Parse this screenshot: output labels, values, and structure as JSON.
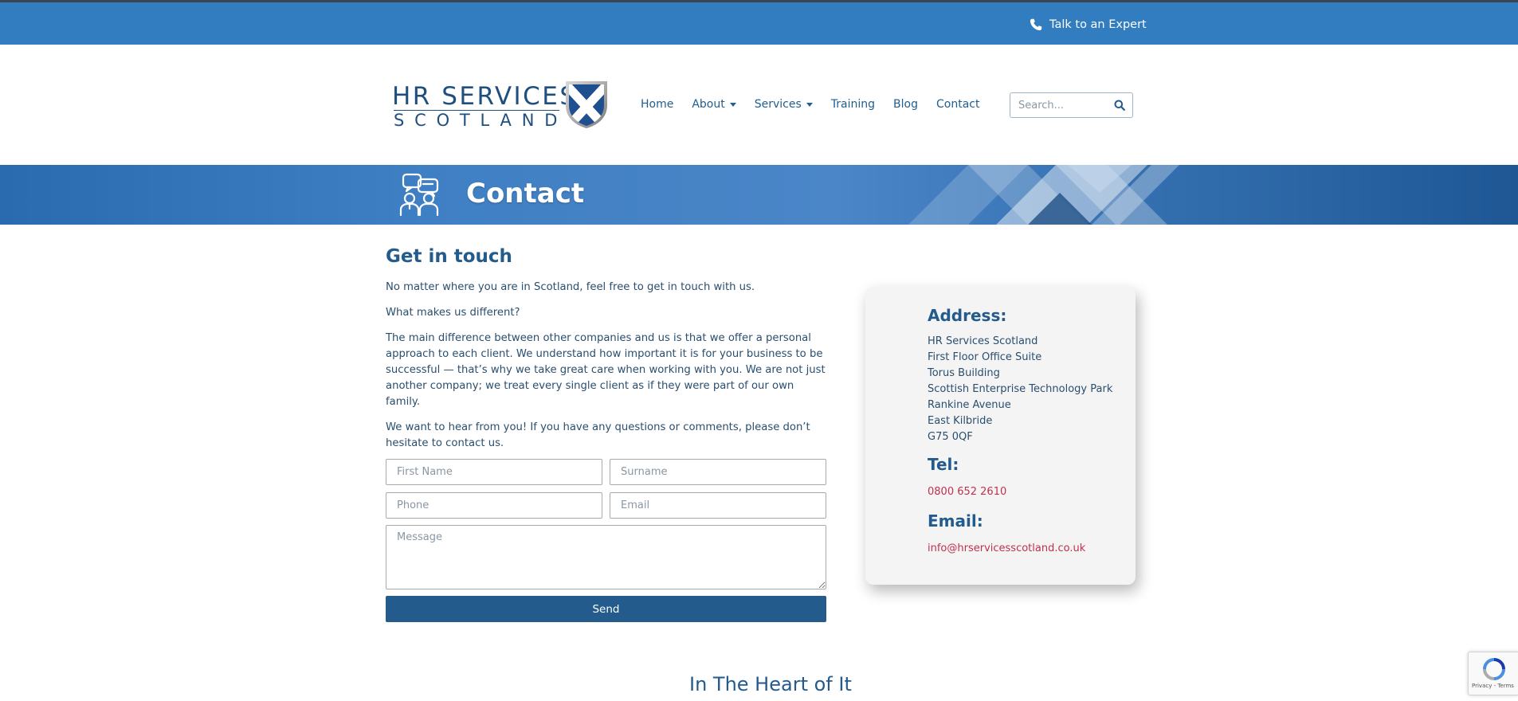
{
  "topbar": {
    "talk_label": "Talk to an Expert",
    "icon": "phone-icon"
  },
  "logo": {
    "line1": "HR SERVICES",
    "line2": "SCOTLAND",
    "icon": "saltire-shield-icon"
  },
  "nav": {
    "items": [
      {
        "label": "Home",
        "has_dropdown": false
      },
      {
        "label": "About",
        "has_dropdown": true
      },
      {
        "label": "Services",
        "has_dropdown": true
      },
      {
        "label": "Training",
        "has_dropdown": false
      },
      {
        "label": "Blog",
        "has_dropdown": false
      },
      {
        "label": "Contact",
        "has_dropdown": false
      }
    ]
  },
  "search": {
    "placeholder": "Search...",
    "icon": "search-icon"
  },
  "banner": {
    "title": "Contact",
    "icon": "chat-people-icon"
  },
  "intro": {
    "heading": "Get in touch",
    "p1": "No matter where you are in Scotland, feel free to get in touch with us.",
    "p2": "What makes us different?",
    "p3": "The main difference between other companies and us is that we offer a personal approach to each client. We understand how important it is for your business to be successful — that’s why we take great care when working with you. We are not just another company; we treat every single client as if they were part of our own family.",
    "p4": "We want to hear from you! If you have any questions or comments, please don’t hesitate to contact us."
  },
  "form": {
    "first_name_placeholder": "First Name",
    "surname_placeholder": "Surname",
    "phone_placeholder": "Phone",
    "email_placeholder": "Email",
    "message_placeholder": "Message",
    "send_label": "Send"
  },
  "contact_card": {
    "address_heading": "Address:",
    "address_lines": [
      "HR Services Scotland",
      "First Floor Office Suite",
      "Torus Building",
      "Scottish Enterprise Technology Park",
      "Rankine Avenue",
      "East Kilbride",
      "G75 0QF"
    ],
    "tel_heading": "Tel:",
    "tel": "0800 652 2610",
    "email_heading": "Email:",
    "email": "info@hrservicesscotland.co.uk"
  },
  "section2": {
    "heading": "In The Heart of It"
  },
  "recaptcha": {
    "text": "Privacy - Terms"
  },
  "colors": {
    "topbar": "#317dc0",
    "brand_blue": "#235b8c",
    "link_red": "#c0304f",
    "card_bg": "#f4f4f4"
  }
}
